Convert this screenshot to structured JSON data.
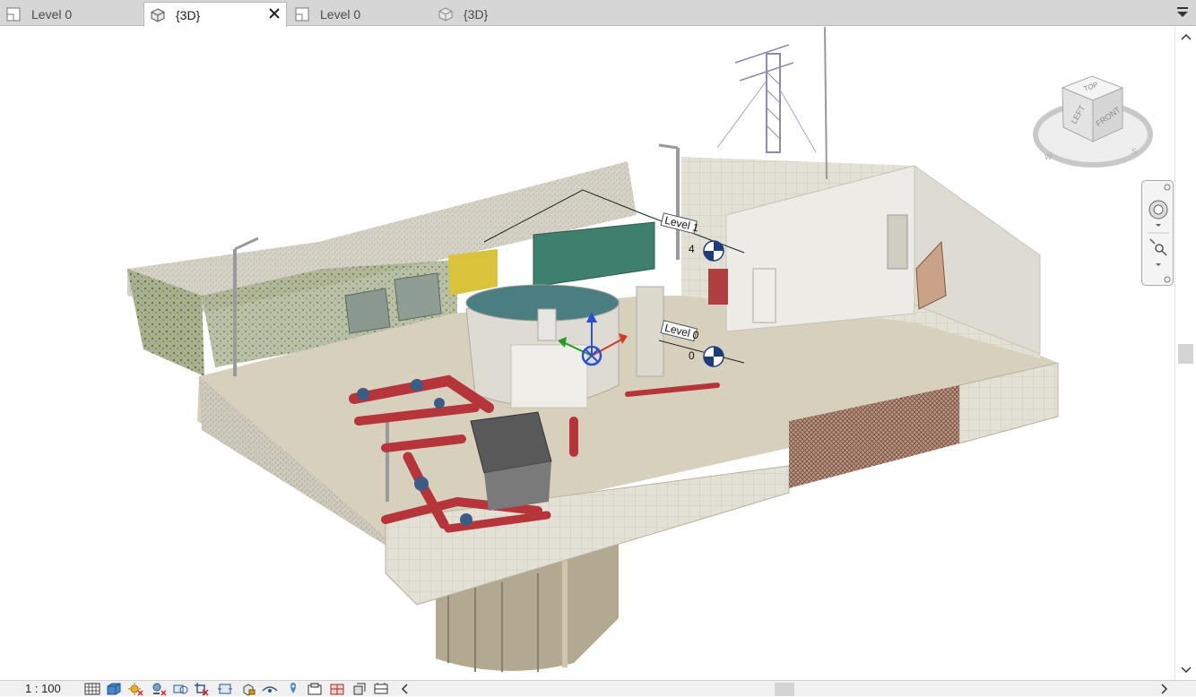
{
  "tabs": [
    {
      "label": "Level 0",
      "icon": "floor-plan-icon",
      "active": false
    },
    {
      "label": "{3D}",
      "icon": "3d-view-icon",
      "active": true
    },
    {
      "label": "Level 0",
      "icon": "floor-plan-icon",
      "active": false
    },
    {
      "label": "{3D}",
      "icon": "3d-view-icon",
      "active": false
    }
  ],
  "viewcube": {
    "top": "TOP",
    "left": "LEFT",
    "front": "FRONT",
    "compass_w": "W",
    "compass_s": "S"
  },
  "levels": [
    {
      "name": "Level 1",
      "value": "4"
    },
    {
      "name": "Level 0",
      "value": "0"
    }
  ],
  "status": {
    "scale": "1 : 100"
  },
  "view_controls": [
    "detail-level-icon",
    "visual-style-icon",
    "sun-path-icon",
    "shadows-icon",
    "render-icon",
    "crop-view-icon",
    "crop-region-icon",
    "unlock-3d-view-icon",
    "temporary-hide-icon",
    "reveal-hidden-icon",
    "temporary-view-props-icon",
    "analytical-model-icon",
    "highlight-displacement-icon",
    "reveal-constraints-icon"
  ],
  "colors": {
    "tab_bar": "#d6d6d6",
    "wall": "#d9d4c5",
    "floor": "#cfc9b6",
    "pipe": "#b5353a",
    "tank_green": "#3f7f6e",
    "level_marker": "#1f3c7a"
  }
}
